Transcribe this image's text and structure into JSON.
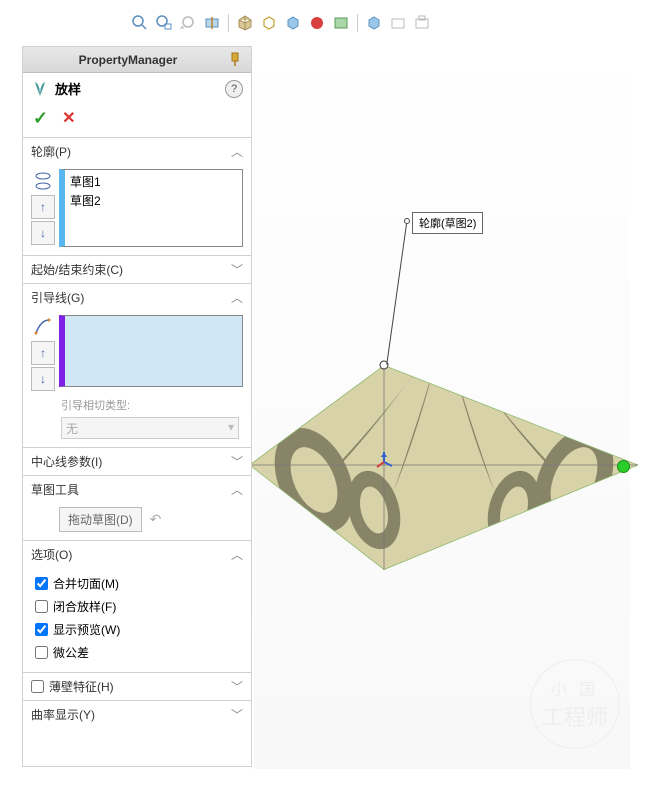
{
  "panel": {
    "header_title": "PropertyManager",
    "feature_name": "放样",
    "sections": {
      "profiles": {
        "label": "轮廓(P)",
        "items": [
          "草图1",
          "草图2"
        ]
      },
      "constraints": {
        "label": "起始/结束约束(C)"
      },
      "guides": {
        "label": "引导线(G)",
        "tangent_label": "引导相切类型:",
        "tangent_value": "无"
      },
      "centerline": {
        "label": "中心线参数(I)"
      },
      "sketch_tools": {
        "label": "草图工具",
        "drag_btn": "拖动草图(D)"
      },
      "options": {
        "label": "选项(O)",
        "merge": {
          "label": "合并切面(M)",
          "checked": true
        },
        "close": {
          "label": "闭合放样(F)",
          "checked": false
        },
        "preview": {
          "label": "显示预览(W)",
          "checked": true
        },
        "micro": {
          "label": "微公差",
          "checked": false
        }
      },
      "thin": {
        "label": "薄壁特征(H)",
        "checked": false
      },
      "curvature": {
        "label": "曲率显示(Y)"
      }
    }
  },
  "viewport": {
    "callout_label": "轮廓(草图2)"
  },
  "watermark": {
    "line1": "小 国",
    "line2": "工程师"
  }
}
